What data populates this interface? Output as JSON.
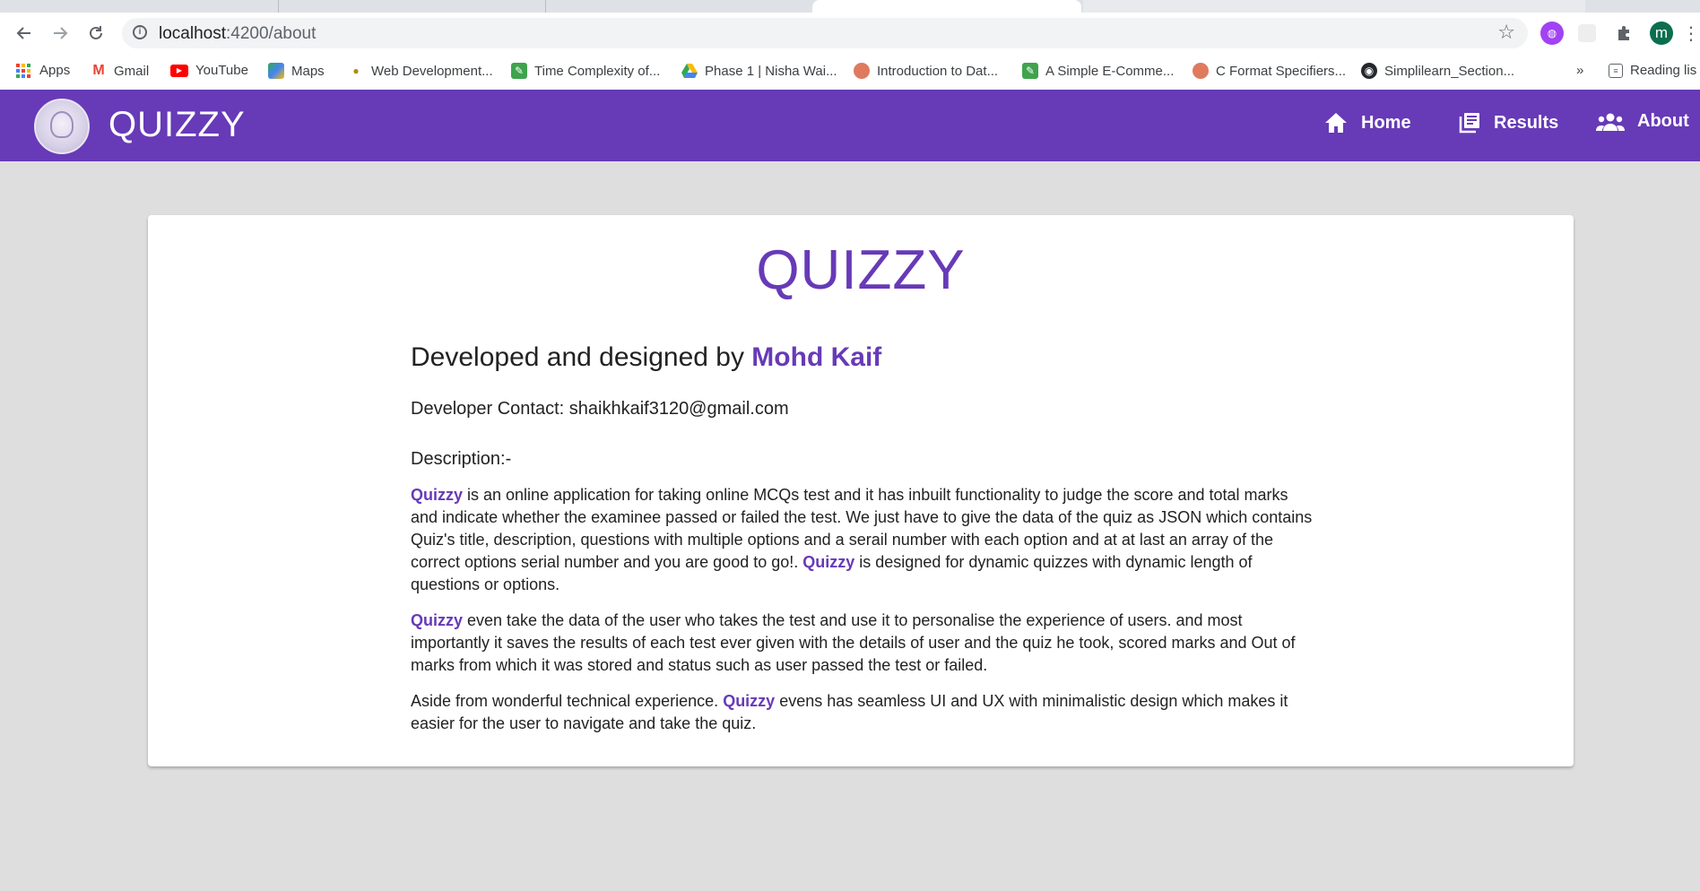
{
  "browser": {
    "url_host": "localhost",
    "url_path": ":4200/about",
    "profile_initial": "m",
    "bookmarks": [
      {
        "label": "Apps",
        "icon": "apps-grid-icon",
        "color": "#ea4335"
      },
      {
        "label": "Gmail",
        "icon": "gmail-icon",
        "color": "#ea4335"
      },
      {
        "label": "YouTube",
        "icon": "youtube-icon",
        "color": "#ff0000"
      },
      {
        "label": "Maps",
        "icon": "maps-icon",
        "color": "#34a853"
      },
      {
        "label": "Web Development...",
        "icon": "web-dev-icon",
        "color": "#fbbc04"
      },
      {
        "label": "Time Complexity of...",
        "icon": "leaf-icon",
        "color": "#3fa34d"
      },
      {
        "label": "Phase 1 | Nisha Wai...",
        "icon": "drive-icon",
        "color": "#1a73e8"
      },
      {
        "label": "Introduction to Dat...",
        "icon": "avatar-icon",
        "color": "#e07a5f"
      },
      {
        "label": "A Simple E-Comme...",
        "icon": "leaf-icon",
        "color": "#3fa34d"
      },
      {
        "label": "C Format Specifiers...",
        "icon": "avatar-icon",
        "color": "#e07a5f"
      },
      {
        "label": "Simplilearn_Section...",
        "icon": "github-icon",
        "color": "#24292e"
      }
    ],
    "overflow_label": "»",
    "reading_list_label": "Reading lis"
  },
  "header": {
    "brand": "QUIZZY",
    "nav": {
      "home": "Home",
      "results": "Results",
      "about": "About"
    }
  },
  "about": {
    "title": "QUIZZY",
    "developed_prefix": "Developed and designed by ",
    "developer_name": "Mohd Kaif",
    "contact_line": "Developer Contact: shaikhkaif3120@gmail.com",
    "description_label": "Description:-",
    "brand_word": "Quizzy",
    "p1_a": " is an online application for taking online MCQs test and it has inbuilt functionality to judge the score and total marks and indicate whether the examinee passed or failed the test. We just have to give the data of the quiz as JSON which contains Quiz's title, description, questions with multiple options and a serail number with each option and at at last an array of the correct options serial number and you are good to go!. ",
    "p1_b": " is designed for dynamic quizzes with dynamic length of questions or options.",
    "p2": " even take the data of the user who takes the test and use it to personalise the experience of users. and most importantly it saves the results of each test ever given with the details of user and the quiz he took, scored marks and Out of marks from which it was stored and status such as user passed the test or failed.",
    "p3_a": "Aside from wonderful technical experience. ",
    "p3_b": " evens has seamless UI and UX with minimalistic design which makes it easier for the user to navigate and take the quiz."
  },
  "colors": {
    "primary": "#673ab7",
    "page_bg": "#dedede"
  }
}
